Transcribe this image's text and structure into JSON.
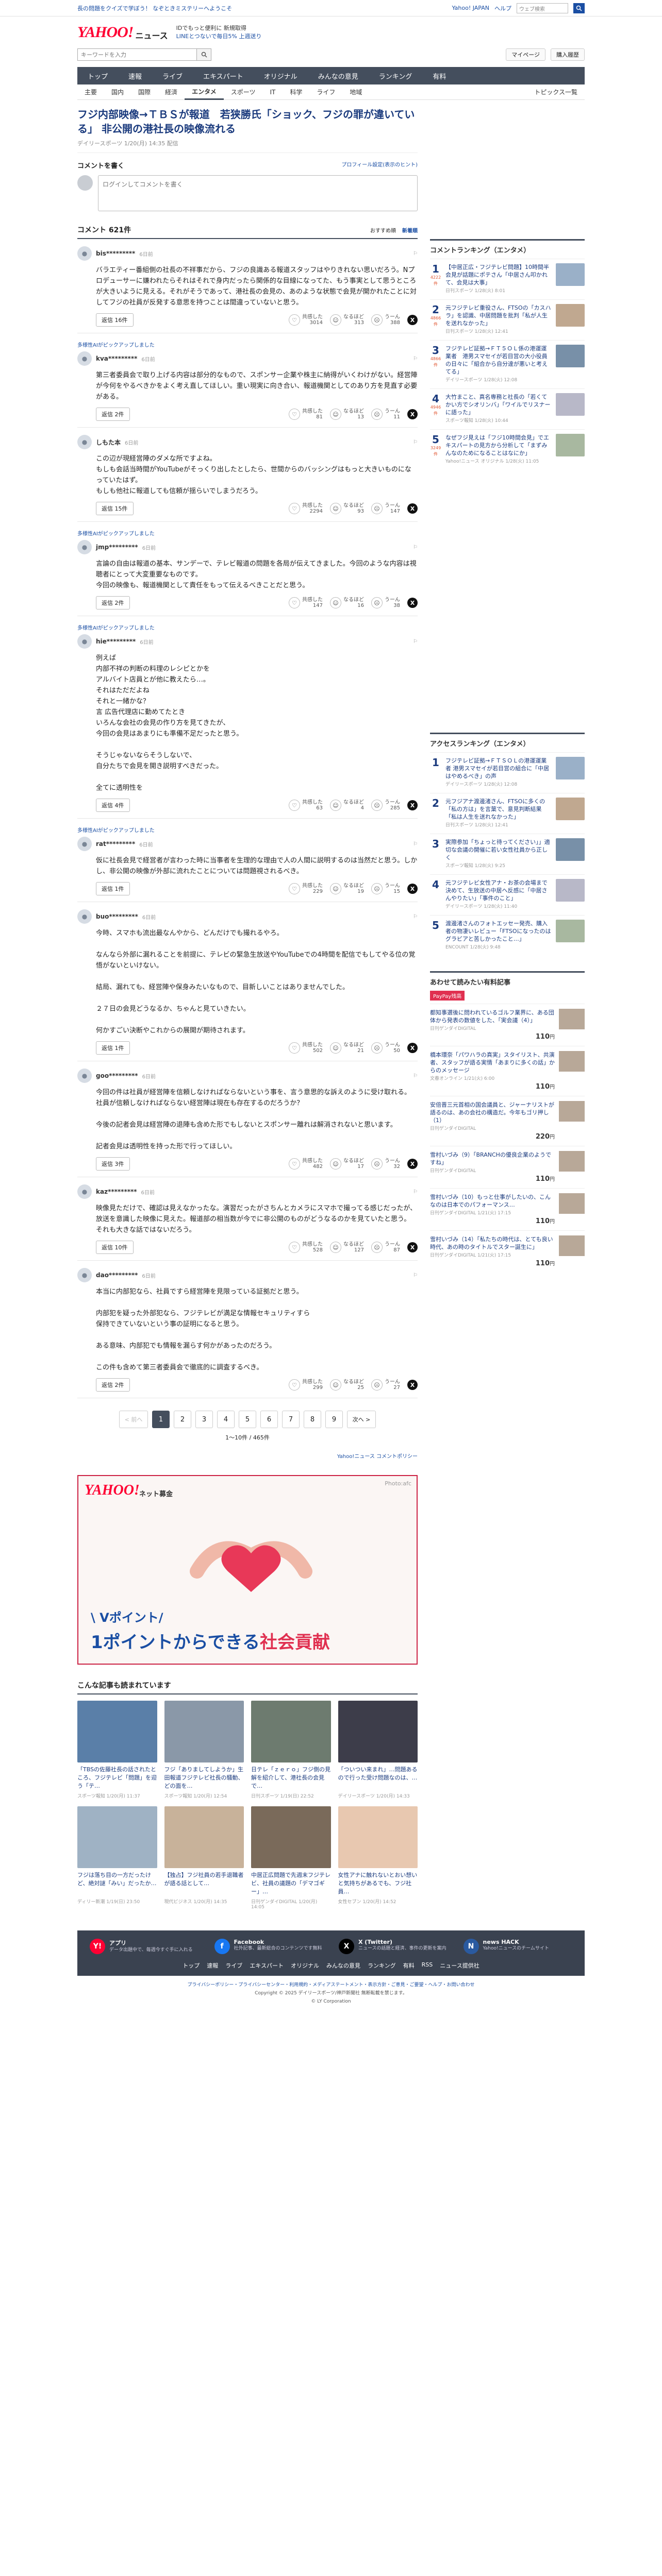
{
  "topbar": {
    "promo": "長の問題をクイズで学ぼう！ なぞときミステリーへようこそ",
    "links": [
      "Yahoo! JAPAN",
      "ヘルプ"
    ],
    "search_placeholder": "ウェブ検索"
  },
  "header": {
    "logo_y": "YAHOO!",
    "logo_japan": "JAPAN",
    "logo_news": "ニュース",
    "tag_line1": "IDでもっと便利に 新規取得",
    "tag_line2": "LINEとつないで毎日5% 上週送り"
  },
  "search": {
    "placeholder": "キーワードを入力",
    "mypage": "マイページ",
    "login": "購入履歴"
  },
  "nav": [
    "トップ",
    "速報",
    "ライブ",
    "エキスパート",
    "オリジナル",
    "みんなの意見",
    "ランキング",
    "有料"
  ],
  "subnav": [
    "主要",
    "国内",
    "国際",
    "経済",
    "エンタメ",
    "スポーツ",
    "IT",
    "科学",
    "ライフ",
    "地域"
  ],
  "subnav_right": "トピックス一覧",
  "article": {
    "title": "フジ内部映像→ＴＢＳが報道　若狭勝氏「ショック、フジの罪が違いている」 非公開の港社長の映像流れる",
    "source": "デイリースポーツ 1/20(月) 14:35 配信"
  },
  "write": {
    "heading": "コメントを書く",
    "profile_link": "プロフィール設定(表示のヒント)",
    "placeholder": "ログインしてコメントを書く"
  },
  "comments_header": {
    "title": "コメント 621件",
    "sort1": "おすすめ順",
    "sort2": "新着順"
  },
  "comments": [
    {
      "pin": "",
      "user": "bis*********",
      "time": "6日前",
      "body": "バラエティー番組側の社長の不祥事だから、フジの良識ある報道スタッフはやりきれない思いだろう。Nプロデューサーに嫌われたらそれはそれで身内だったら関係的な目線になってた、もう事実として思うところが大きいように見える。それがそうであって、港社長の会見の、あのような状態で会見が開かれたことに対してフジの社員が反発する意思を持つことは間違っていないと思う。",
      "reply": "返信 16件",
      "likes": "3014",
      "think": "313",
      "dislike": "388"
    },
    {
      "pin": "多様性AIがピックアップしました",
      "user": "kva*********",
      "time": "6日前",
      "body": "第三者委員会で取り上げる内容は部分的なもので、スポンサー企業や株主に納得がいくわけがない。経営陣が今何をやるべきかをよく考え直してほしい。重い現実に向き合い、報道機関としてのあり方を見直す必要がある。",
      "reply": "返信 2件",
      "likes": "81",
      "think": "13",
      "dislike": "11"
    },
    {
      "pin": "",
      "user": "しもた本",
      "time": "6日前",
      "body": "この辺が現経営陣のダメな所ですよね。\nもしも会話当時間がYouTubeがそっくり出したとしたら、世間からのバッシングはもっと大きいものになっていたはず。\nもしも他社に報道しても信頼が揺らいでしまうだろう。",
      "reply": "返信 15件",
      "likes": "2294",
      "think": "93",
      "dislike": "147"
    },
    {
      "pin": "多様性AIがピックアップしました",
      "user": "jmp*********",
      "time": "6日前",
      "body": "言論の自由は報道の基本、サンデーで、テレビ報道の問題を各局が伝えてきました。今回のような内容は視聴者にとって大変重要なものです。\n今回の映像も、報道機関として責任をもって伝えるべきことだと思う。",
      "reply": "返信 2件",
      "likes": "147",
      "think": "16",
      "dislike": "38"
    },
    {
      "pin": "多様性AIがピックアップしました",
      "user": "hie*********",
      "time": "6日前",
      "body": "例えば\n内部不祥の判断の料理のレシピとかを\nアルバイト店員とが他に教えたら…。\nそれはただだよね\nそれと一緒かな？\n言 広告代理店に勤めてたとき\nいろんな会社の会見の作り方を見てきたが、\n今回の会見はあまりにも準備不足だったと思う。\n\nそうじゃないならそうしないで、\n自分たちで会見を開き説明すべきだった。\n\n全てに透明性を",
      "reply": "返信 4件",
      "likes": "63",
      "think": "4",
      "dislike": "285"
    },
    {
      "pin": "多様性AIがピックアップしました",
      "user": "rat*********",
      "time": "6日前",
      "body": "仮に社長会見で経営者が言わった時に当事者を生理的な理由で人の人間に説明するのは当然だと思う。しかし、非公開の映像が外部に流れたことについては問題視されるべき。",
      "reply": "返信 1件",
      "likes": "229",
      "think": "19",
      "dislike": "15"
    },
    {
      "pin": "",
      "user": "buo*********",
      "time": "6日前",
      "body": "今時、スマホも流出最なんやから、どんだけでも撮れるやろ。\n\nなんなら外部に漏れることを前提に、テレビの緊急生放送やYouTubeでの4時間を配信でもしてやる位の覚悟がないといけない。\n\n結局、漏れても、経営陣や保身みたいなもので、目新しいことはありませんでした。\n\n２７日の会見どうなるか、ちゃんと見ていきたい。\n\n何かすごい決断やこれからの展開が期待されます。",
      "reply": "返信 1件",
      "likes": "502",
      "think": "21",
      "dislike": "50"
    },
    {
      "pin": "",
      "user": "goo*********",
      "time": "6日前",
      "body": "今回の件は社員が経営陣を信頼しなければならないという事を、言う意思的な訴えのように受け取れる。\n社員が信頼しなければならない経営陣は現在も存在するのだろうか？\n\n今後の記者会見は経営陣の退陣も含めた形でもしないとスポンサー離れは解消されないと思います。\n\n記者会見は透明性を持った形で行ってほしい。",
      "reply": "返信 3件",
      "likes": "482",
      "think": "17",
      "dislike": "32"
    },
    {
      "pin": "",
      "user": "kaz*********",
      "time": "6日前",
      "body": "映像見ただけで、確認は見えなかったな。演習だったがさちんとカメラにスマホで撮ってる感じだったが、放送を意識した映像に見えた。報道部の相当数が今でに非公開のものがどうなるのかを見ていたと思う。\nそれも大きな話ではないだろう。",
      "reply": "返信 10件",
      "likes": "528",
      "think": "127",
      "dislike": "87"
    },
    {
      "pin": "",
      "user": "dao*********",
      "time": "6日前",
      "body": "本当に内部犯なら、社員ですら経営陣を見限っている証拠だと思う。\n\n内部犯を疑った外部犯なら、フジテレビが満足な情報セキュリティすら\n保持できていないという事の証明になると思う。\n\nある意味、内部犯でも情報を漏らす何かがあったのだろう。\n\nこの件も含めて第三者委員会で徹底的に調査するべき。",
      "reply": "返信 2件",
      "likes": "299",
      "think": "25",
      "dislike": "27"
    }
  ],
  "actions": {
    "like": "共感した",
    "think": "なるほど",
    "dislike": "うーん"
  },
  "pager": {
    "prev": "< 前へ",
    "next": "次へ >",
    "pages": [
      "1",
      "2",
      "3",
      "4",
      "5",
      "6",
      "7",
      "8",
      "9"
    ],
    "info": "1〜10件 / 465件",
    "policy": "Yahoo!ニュース コメントポリシー"
  },
  "ad": {
    "logo": "YAHOO!",
    "logo_sub": "ネット募金",
    "credit": "Photo:afc",
    "line1": "\\ Vポイント/",
    "line2a": "1ポイントからできる",
    "line2b": "社会貢献"
  },
  "recs": {
    "title": "こんな記事も読まれています",
    "items": [
      {
        "title": "「TBSの佐藤社長の話されたところ、フジテレビ「問題」を迎う「テ…",
        "src": "スポーツ報知 1/20(月) 11:37"
      },
      {
        "title": "フジ「ありましてしようか」生田報道フジテレビ社長の騒動、どの面を…",
        "src": "スポーツ報知 1/20(月) 12:54"
      },
      {
        "title": "日テレ「ｚｅｒｏ」フジ側の見解を紹介して、港社長の会見で…",
        "src": "日刊スポーツ 1/19(日) 22:52"
      },
      {
        "title": "「ついつい来まれ」…問題あるので行った受け問題なのは、…",
        "src": "デイリースポーツ 1/20(月) 14:33"
      },
      {
        "title": "フジは落ち目の一方だったけど、絶対謎「みい」だったか…",
        "src": "ディリー新潮 1/19(日) 23:50"
      },
      {
        "title": "【独占】フジ社員の若手退職者が語る話として…",
        "src": "現代ビジネス 1/20(月) 14:35"
      },
      {
        "title": "中居正広問題で先週末フジテレビ、社員の議題の「デマゴギー」…",
        "src": "日刊ゲンダイDIGITAL 1/20(月) 14:05"
      },
      {
        "title": "女性アナに触れないとおい想いと気持ちがあるでも、フジ社員…",
        "src": "女性セブン 1/20(月) 14:52"
      }
    ]
  },
  "ranking": {
    "title": "コメントランキング（エンタメ）",
    "items": [
      {
        "no": "1",
        "cnt": "4222件",
        "title": "【中居正広・フジテレビ問題】10時間半会見が話題にポテさん「中居さん叩かれて、会見は大事」",
        "src": "日刊スポーツ 1/28(火) 8:01"
      },
      {
        "no": "2",
        "cnt": "4866件",
        "title": "元フジテレビ重役さん、FTSOの「カスハラ」を認識、中居問題を批判「私が人生を送れなかった」",
        "src": "日刊スポーツ 1/28(火) 12:41"
      },
      {
        "no": "3",
        "cnt": "4866件",
        "title": "フジテレビ証拠→ＦＴ５ＯＬ係の港運運業者　港男スマセイが若目営の大小役員の日々に「組合から自分達が悪いと考えてる」",
        "src": "デイリースポーツ 1/28(火) 12:08"
      },
      {
        "no": "4",
        "cnt": "4946件",
        "title": "大竹まこと、真名専務と社長の「若くてかい方でシオリンバ」「ワイルでリスナーに語った」",
        "src": "スポーツ報知 1/28(火) 10:44"
      },
      {
        "no": "5",
        "cnt": "3249件",
        "title": "なぜフジ見えは「フジ10時間会見」でエキスパートの見方から分析して「まずみんなのためになることはなにか」",
        "src": "Yahoo!ニュース オリジナル 1/28(火) 11:05"
      }
    ]
  },
  "access": {
    "title": "アクセスランキング（エンタメ）",
    "items": [
      {
        "no": "1",
        "title": "フジテレビ証拠→ＦＴＳＯＬの港運運業者 港男スマセイが若目営の組合に「中居はやめるべき」の声",
        "src": "デイリースポーツ 1/28(火) 12:08"
      },
      {
        "no": "2",
        "title": "元フジアナ渡邊渚さん、FTSOに多くの「私の方は」を言葉で、意見判断結果「私は人生を送れなかった」",
        "src": "日刊スポーツ 1/28(火) 12:41"
      },
      {
        "no": "3",
        "title": "実際参加「ちょっと待ってください」」適切な会議の開催に若い女性社員から正しく",
        "src": "スポーツ報知 1/28(火) 9:25"
      },
      {
        "no": "4",
        "title": "元フジテレビ女性アナ・お茶の会場まで決めて、生放送の中居へ反感に「中居さんやりたい」「事件のこと」",
        "src": "デイリースポーツ 1/28(火) 11:40"
      },
      {
        "no": "5",
        "title": "渡邊渚さんのフォトエッセー発売、購入者の物凄いレビュー「FTSOになったのはグラビアと苦しかったこと…」",
        "src": "ENCOUNT 1/28(火) 9:48"
      }
    ]
  },
  "shopping": {
    "title": "あわせて読みたい有料記事",
    "badge": "PayPay残高",
    "items": [
      {
        "title": "都知事選後に問われているゴルフ業界に、ある団体から発表の数値をした、「実会議（4）」",
        "src": "日刊ゲンダイDIGITAL",
        "price": "110"
      },
      {
        "title": "橋本環奈「パワハラの真実」スタイリスト、共演者、スタッフが語る実情「あまりに多くの話」からのメッセージ",
        "src": "文春オンライン 1/21(火) 6:00",
        "price": "110"
      },
      {
        "title": "安倍晋三元首相の国会議員と、ジャーナリストが語るのは、あの会社の構造だ。今年もゴリ押し（1）",
        "src": "日刊ゲンダイDIGITAL",
        "price": "220"
      },
      {
        "title": "雪村いづみ（9）「BRANCHの優良企業のようですね」",
        "src": "日刊ゲンダイDIGITAL",
        "price": "110"
      },
      {
        "title": "雪村いづみ（10）もっと仕事がしたいの、こんなのは日本でのパフォーマンス…",
        "src": "日刊ゲンダイDIGITAL 1/21(火) 17:15",
        "price": "110"
      },
      {
        "title": "雪村いづみ（14）「私たちの時代は、とても良い時代、あの時のタイトルでスター誕生に」",
        "src": "日刊ゲンダイDIGITAL 1/21(火) 17:15",
        "price": "110"
      }
    ]
  },
  "footer": {
    "apps": [
      {
        "name": "アプリ",
        "desc": "データ出題中で、毎週今すぐ手に入れる",
        "icon": "Y!",
        "color": "#ff0033"
      },
      {
        "name": "Facebook",
        "desc": "社外記事、最新総合のコンテンツです無料",
        "icon": "f",
        "color": "#1877f2"
      },
      {
        "name": "X (Twitter)",
        "desc": "ニュースの話題と経済、事件の更新を案内",
        "icon": "X",
        "color": "#000000"
      },
      {
        "name": "news HACK",
        "desc": "Yahoo!ニュースのチームサイト",
        "icon": "N",
        "color": "#2a5aa0"
      }
    ],
    "links": [
      "トップ",
      "速報",
      "ライブ",
      "エキスパート",
      "オリジナル",
      "みんなの意見",
      "ランキング",
      "有料",
      "RSS",
      "ニュース提供社"
    ],
    "legal": "プライバシーポリシー・プライバシーセンター・利用規約・メディアステートメント・表示方針・ご意見・ご要望・ヘルプ・お問い合わせ",
    "copyright": "Copyright © 2025 デイリースポーツ/神戸新聞社 無断転載を禁じます。",
    "corp": "© LY Corporation"
  }
}
